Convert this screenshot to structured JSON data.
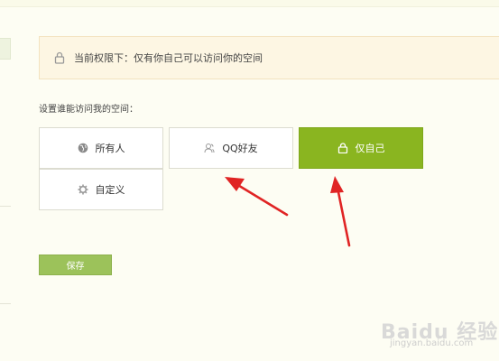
{
  "notice": {
    "text": "当前权限下：仅有你自己可以访问你的空间"
  },
  "section_label": "设置谁能访问我的空间：",
  "options": [
    {
      "label": "所有人",
      "icon": "globe-icon",
      "selected": false
    },
    {
      "label": "QQ好友",
      "icon": "friends-icon",
      "selected": false
    },
    {
      "label": "仅自己",
      "icon": "lock-icon",
      "selected": true
    },
    {
      "label": "自定义",
      "icon": "gear-icon",
      "selected": false
    }
  ],
  "save_label": "保存",
  "watermark": {
    "brand": "Baidu 经验",
    "url": "jingyan.baidu.com"
  },
  "colors": {
    "accent": "#8ab520",
    "save": "#9cc25a",
    "arrow": "#e02424",
    "notice_bg": "#fdf6e3"
  }
}
